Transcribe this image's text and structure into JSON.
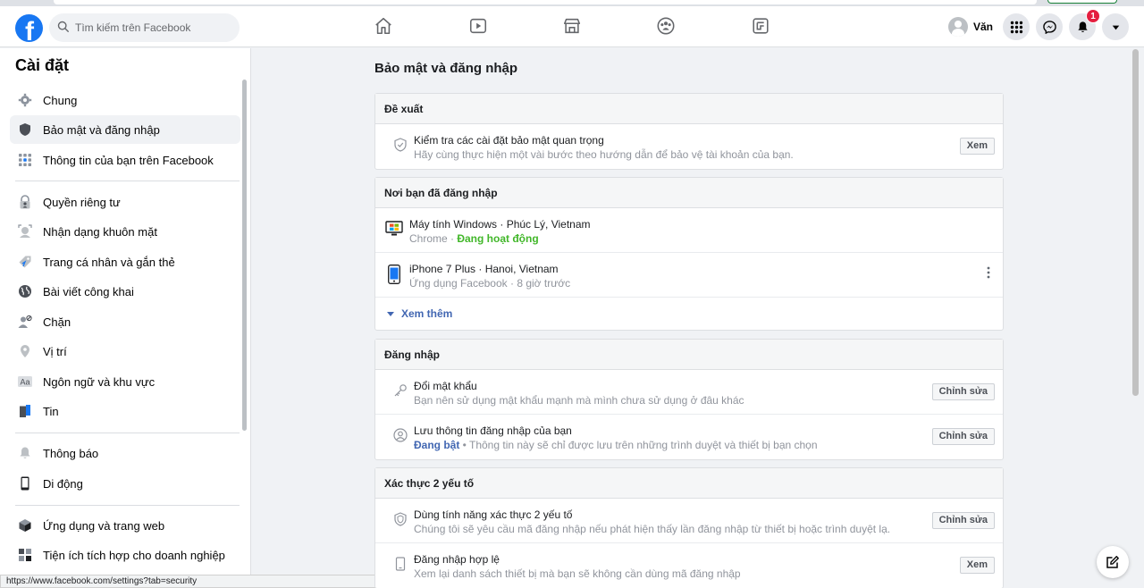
{
  "header": {
    "logo_letter": "f",
    "search_placeholder": "Tìm kiếm trên Facebook",
    "nav_icons": [
      "home-icon",
      "watch-icon",
      "marketplace-icon",
      "groups-icon",
      "gaming-icon"
    ],
    "profile_name": "Văn",
    "notification_count": "1",
    "right_icons": [
      "menu-grid-icon",
      "messenger-icon",
      "bell-icon",
      "caret-down-icon"
    ]
  },
  "sidebar": {
    "title": "Cài đặt",
    "items": [
      {
        "label": "Chung",
        "icon": "gear-icon"
      },
      {
        "label": "Bảo mật và đăng nhập",
        "icon": "shield-icon",
        "active": true
      },
      {
        "label": "Thông tin của bạn trên Facebook",
        "icon": "facebook-grid-icon"
      },
      {
        "label": "Quyền riêng tư",
        "icon": "lock-person-icon"
      },
      {
        "label": "Nhận dạng khuôn mặt",
        "icon": "face-id-icon"
      },
      {
        "label": "Trang cá nhân và gắn thẻ",
        "icon": "tag-icon"
      },
      {
        "label": "Bài viết công khai",
        "icon": "globe-icon"
      },
      {
        "label": "Chặn",
        "icon": "block-user-icon"
      },
      {
        "label": "Vị trí",
        "icon": "location-pin-icon"
      },
      {
        "label": "Ngôn ngữ và khu vực",
        "icon": "language-aa-icon"
      },
      {
        "label": "Tin",
        "icon": "story-book-icon"
      },
      {
        "label": "Thông báo",
        "icon": "bell-icon"
      },
      {
        "label": "Di động",
        "icon": "mobile-phone-icon"
      },
      {
        "label": "Ứng dụng và trang web",
        "icon": "cube-icon"
      },
      {
        "label": "Tiện ích tích hợp cho doanh nghiệp",
        "icon": "business-integration-icon"
      }
    ]
  },
  "status_url": "https://www.facebook.com/settings?tab=security",
  "main": {
    "title": "Bảo mật và đăng nhập",
    "recommended": {
      "header": "Đề xuất",
      "rows": [
        {
          "title": "Kiểm tra các cài đặt bảo mật quan trọng",
          "subtitle": "Hãy cùng thực hiện một vài bước theo hướng dẫn để bảo vệ tài khoản của bạn.",
          "button": "Xem"
        }
      ]
    },
    "where_logged_in": {
      "header": "Nơi bạn đã đăng nhập",
      "devices": [
        {
          "title": "Máy tính Windows · Phúc Lý, Vietnam",
          "browser": "Chrome · ",
          "status": "Đang hoạt động"
        },
        {
          "title": "iPhone 7 Plus · Hanoi, Vietnam",
          "subtitle": "Ứng dụng Facebook · 8 giờ trước"
        }
      ],
      "see_more": "Xem thêm"
    },
    "login": {
      "header": "Đăng nhập",
      "rows": [
        {
          "title": "Đổi mật khẩu",
          "subtitle": "Bạn nên sử dụng mật khẩu mạnh mà mình chưa sử dụng ở đâu khác",
          "button": "Chỉnh sửa"
        },
        {
          "title": "Lưu thông tin đăng nhập của bạn",
          "status": "Đang bật",
          "subtitle": " • Thông tin này sẽ chỉ được lưu trên những trình duyệt và thiết bị bạn chọn",
          "button": "Chỉnh sửa"
        }
      ]
    },
    "two_factor": {
      "header": "Xác thực 2 yếu tố",
      "rows": [
        {
          "title": "Dùng tính năng xác thực 2 yếu tố",
          "subtitle": "Chúng tôi sẽ yêu cầu mã đăng nhập nếu phát hiện thấy lần đăng nhập từ thiết bị hoặc trình duyệt lạ.",
          "button": "Chỉnh sửa"
        },
        {
          "title": "Đăng nhập hợp lệ",
          "subtitle": "Xem lại danh sách thiết bị mà bạn sẽ không cần dùng mã đăng nhập",
          "button": "Xem"
        }
      ]
    }
  },
  "colors": {
    "brand": "#1877f2",
    "link": "#4267b2",
    "active_green": "#42b72a",
    "badge_red": "#e41e3f"
  }
}
